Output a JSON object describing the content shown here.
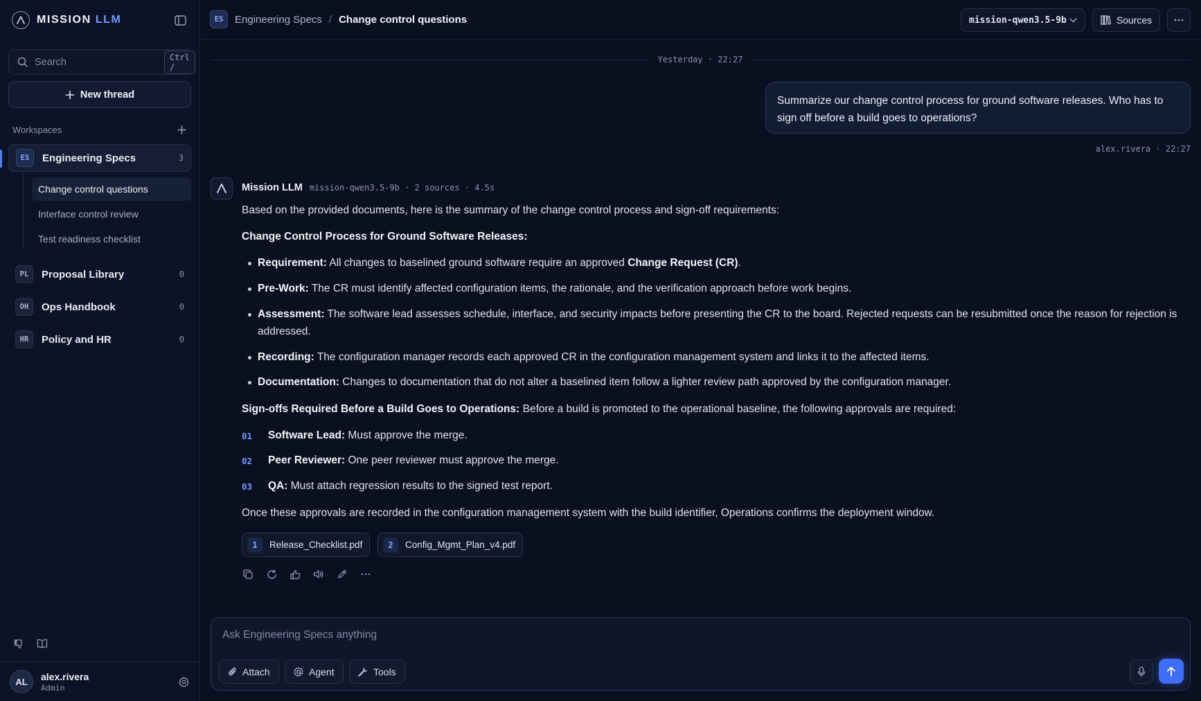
{
  "brand": {
    "name_main": "MISSION",
    "name_accent": "LLM"
  },
  "search": {
    "placeholder": "Search",
    "shortcut": "Ctrl /"
  },
  "sidebar": {
    "new_thread_label": "New thread",
    "workspaces_label": "Workspaces",
    "workspaces": [
      {
        "initials": "ES",
        "name": "Engineering Specs",
        "count": "3"
      },
      {
        "initials": "PL",
        "name": "Proposal Library",
        "count": "0"
      },
      {
        "initials": "OH",
        "name": "Ops Handbook",
        "count": "0"
      },
      {
        "initials": "HR",
        "name": "Policy and HR",
        "count": "0"
      }
    ],
    "threads": [
      {
        "label": "Change control questions"
      },
      {
        "label": "Interface control review"
      },
      {
        "label": "Test readiness checklist"
      }
    ]
  },
  "user": {
    "initials": "AL",
    "name": "alex.rivera",
    "role": "Admin"
  },
  "header": {
    "workspace_initials": "ES",
    "workspace": "Engineering Specs",
    "separator": "/",
    "thread": "Change control questions",
    "model": "mission-qwen3.5-9b",
    "sources_label": "Sources"
  },
  "chat": {
    "date_divider": "Yesterday · 22:27",
    "user_message": "Summarize our change control process for ground software releases. Who has to sign off before a build goes to operations?",
    "user_meta": "alex.rivera · 22:27",
    "assistant": {
      "name": "Mission LLM",
      "meta": "mission-qwen3.5-9b · 2 sources · 4.5s",
      "intro": "Based on the provided documents, here is the summary of the change control process and sign-off requirements:",
      "section1_title": "Change Control Process for Ground Software Releases:",
      "bullets": [
        {
          "label": "Requirement:",
          "text_a": " All changes to baselined ground software require an approved ",
          "strong": "Change Request (CR)",
          "text_b": "."
        },
        {
          "label": "Pre-Work:",
          "text": " The CR must identify affected configuration items, the rationale, and the verification approach before work begins."
        },
        {
          "label": "Assessment:",
          "text": " The software lead assesses schedule, interface, and security impacts before presenting the CR to the board. Rejected requests can be resubmitted once the reason for rejection is addressed."
        },
        {
          "label": "Recording:",
          "text": " The configuration manager records each approved CR in the configuration management system and links it to the affected items."
        },
        {
          "label": "Documentation:",
          "text": " Changes to documentation that do not alter a baselined item follow a lighter review path approved by the configuration manager."
        }
      ],
      "section2_title": "Sign-offs Required Before a Build Goes to Operations:",
      "section2_text": " Before a build is promoted to the operational baseline, the following approvals are required:",
      "signoffs": [
        {
          "num": "01",
          "label": "Software Lead:",
          "text": " Must approve the merge."
        },
        {
          "num": "02",
          "label": "Peer Reviewer:",
          "text": " One peer reviewer must approve the merge."
        },
        {
          "num": "03",
          "label": "QA:",
          "text": " Must attach regression results to the signed test report."
        }
      ],
      "closing": "Once these approvals are recorded in the configuration management system with the build identifier, Operations confirms the deployment window.",
      "sources": [
        {
          "num": "1",
          "file": "Release_Checklist.pdf"
        },
        {
          "num": "2",
          "file": "Config_Mgmt_Plan_v4.pdf"
        }
      ]
    }
  },
  "composer": {
    "placeholder": "Ask Engineering Specs anything",
    "attach_label": "Attach",
    "agent_label": "Agent",
    "tools_label": "Tools"
  },
  "colors": {
    "accent": "#3d6ef5",
    "background": "#0b1020",
    "sidebar": "#0d1326"
  },
  "icons": [
    "logo-icon",
    "sidebar-toggle-icon",
    "search-icon",
    "plus-icon",
    "feedback-icon",
    "book-icon",
    "gear-icon",
    "chevron-down-icon",
    "library-icon",
    "ellipsis-icon",
    "copy-icon",
    "refresh-icon",
    "thumbs-up-icon",
    "speaker-icon",
    "edit-icon",
    "paperclip-icon",
    "at-icon",
    "wrench-icon",
    "mic-icon",
    "arrow-up-icon"
  ]
}
